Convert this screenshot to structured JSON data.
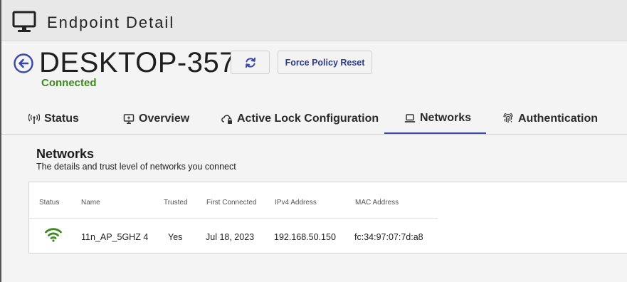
{
  "header": {
    "title": "Endpoint Detail",
    "icon": "monitor-icon"
  },
  "device": {
    "name": "DESKTOP-357",
    "status": "Connected",
    "status_color": "#3f8a1f",
    "refresh_icon": "refresh-icon",
    "force_policy_label": "Force Policy Reset"
  },
  "tabs": [
    {
      "label": "Status",
      "icon": "antenna-icon"
    },
    {
      "label": "Overview",
      "icon": "monitor-icon"
    },
    {
      "label": "Active Lock Configuration",
      "icon": "cloud-lock-icon"
    },
    {
      "label": "Networks",
      "icon": "laptop-icon",
      "active": true
    },
    {
      "label": "Authentication",
      "icon": "fingerprint-icon"
    }
  ],
  "networks": {
    "title": "Networks",
    "description": "The details and trust level of networks you connect",
    "columns": [
      "Status",
      "Name",
      "Trusted",
      "First Connected",
      "IPv4 Address",
      "MAC Address"
    ],
    "rows": [
      {
        "status_icon": "wifi-icon",
        "name": "11n_AP_5GHZ 4",
        "trusted": "Yes",
        "first_connected": "Jul 18, 2023",
        "ipv4": "192.168.50.150",
        "mac": "fc:34:97:07:7d:a8"
      }
    ]
  },
  "colors": {
    "accent": "#3a46a8",
    "connected": "#3f8a1f",
    "wifi": "#3f8a1f"
  }
}
